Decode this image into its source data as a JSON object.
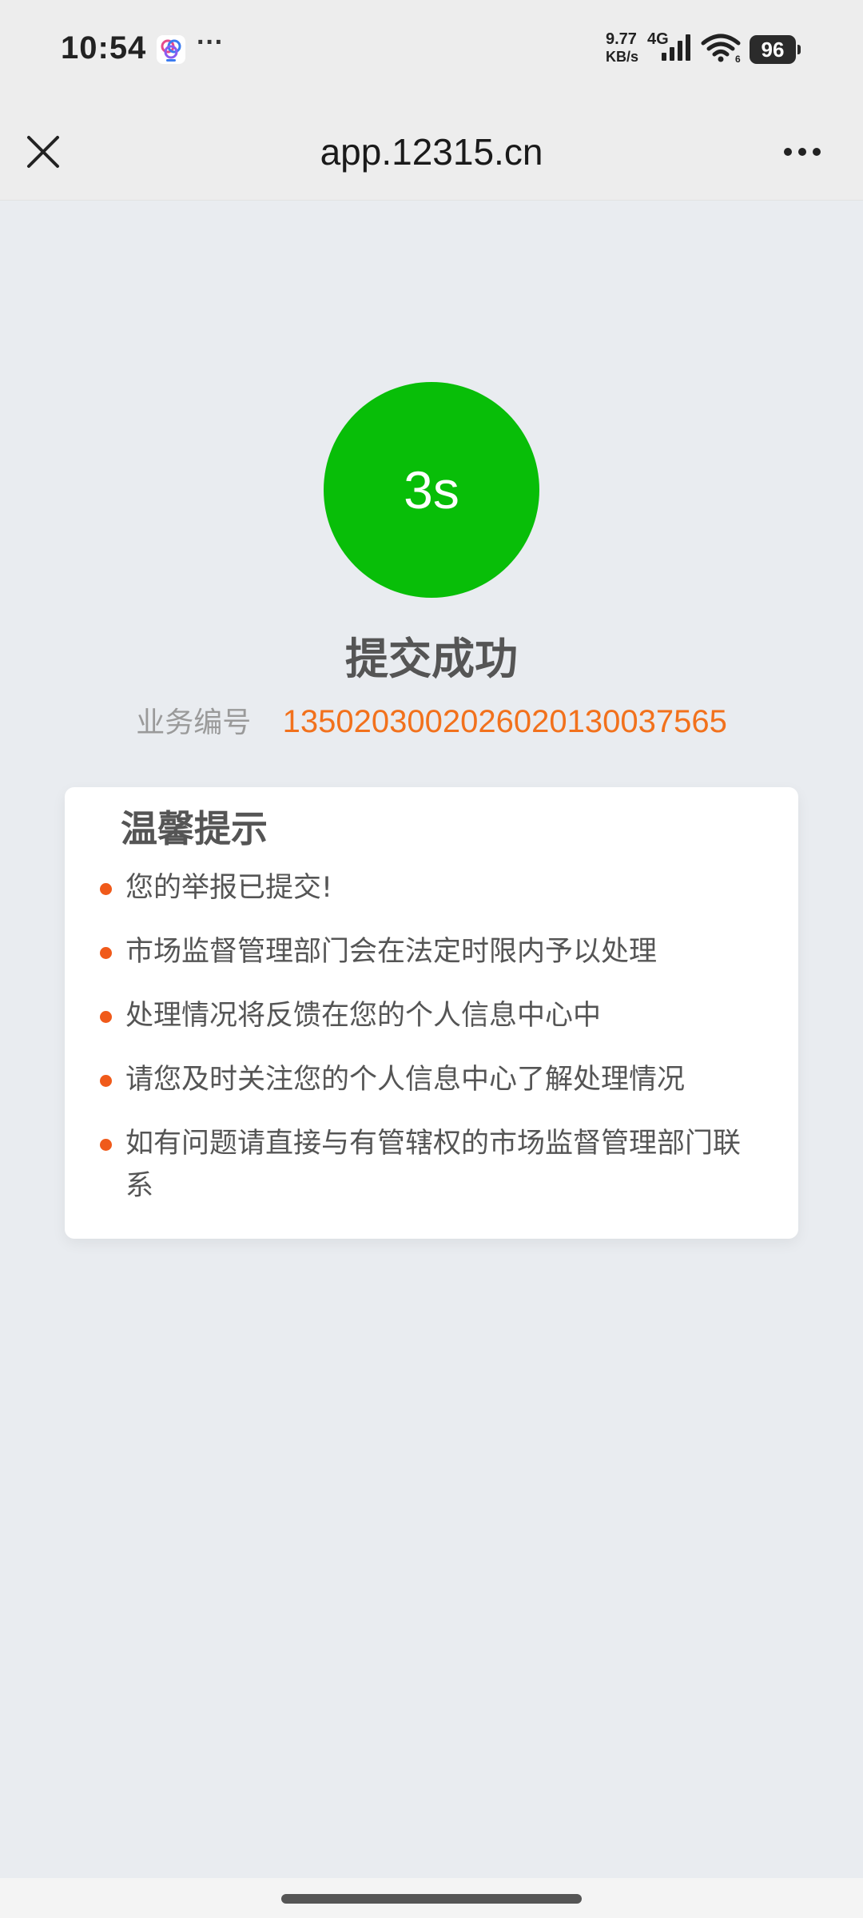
{
  "status_bar": {
    "time": "10:54",
    "more": "···",
    "net_speed_value": "9.77",
    "net_speed_unit": "KB/s",
    "network_type": "4G",
    "battery": "96",
    "app_icon": "browser-app-icon",
    "signal_icon": "cellular-signal-icon",
    "wifi_icon": "wifi-icon"
  },
  "nav": {
    "title": "app.12315.cn",
    "close_icon": "close-icon",
    "more_icon": "more-horizontal-icon"
  },
  "result": {
    "countdown": "3s",
    "title": "提交成功",
    "order_label": "业务编号",
    "order_number": "13502030020260201300375‍65",
    "accent_color": "#08be08",
    "number_color": "#f2711c"
  },
  "tips": {
    "title": "温馨提示",
    "items": [
      "您的举报已提交!",
      "市场监督管理部门会在法定时限内予以处理",
      "处理情况将反馈在您的个人信息中心中",
      "请您及时关注您的个人信息中心了解处理情况",
      "如有问题请直接与有管辖权的市场监督管理部门联系"
    ],
    "bullet_color": "#f05a1a"
  }
}
